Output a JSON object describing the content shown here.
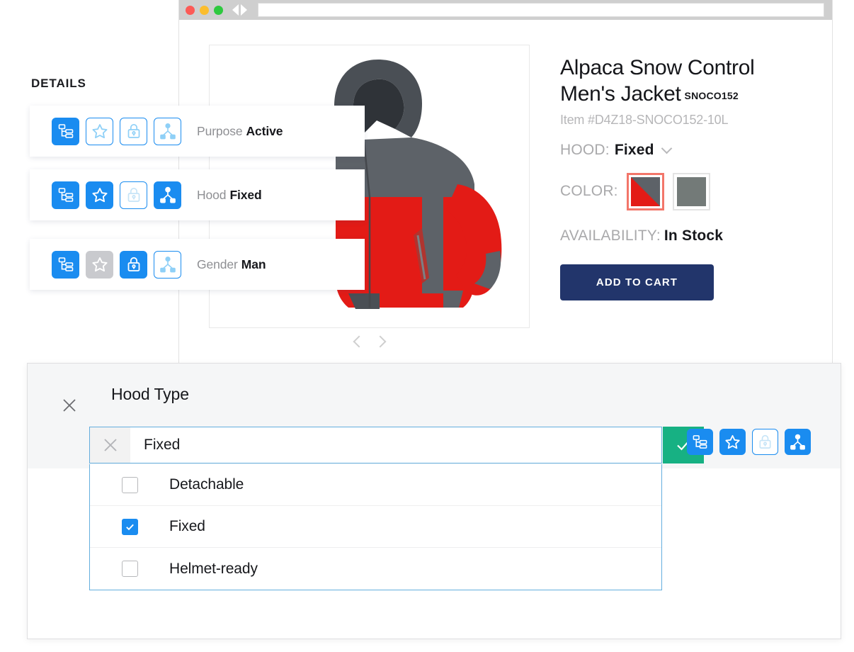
{
  "browser": {
    "traffic_lights": [
      "close",
      "minimize",
      "zoom"
    ],
    "back_label": "Back",
    "forward_label": "Forward",
    "url_value": "",
    "url_placeholder": ""
  },
  "details_panel": {
    "heading": "DETAILS",
    "rows": [
      {
        "label": "Purpose",
        "value": "Active",
        "icons": [
          {
            "name": "hierarchy-icon",
            "state": "fill"
          },
          {
            "name": "star-icon",
            "state": "outline"
          },
          {
            "name": "lock-icon",
            "state": "outline"
          },
          {
            "name": "network-icon",
            "state": "outline"
          }
        ]
      },
      {
        "label": "Hood",
        "value": "Fixed",
        "icons": [
          {
            "name": "hierarchy-icon",
            "state": "fill"
          },
          {
            "name": "star-icon",
            "state": "fill"
          },
          {
            "name": "lock-icon",
            "state": "outline"
          },
          {
            "name": "network-icon",
            "state": "fill"
          }
        ]
      },
      {
        "label": "Gender",
        "value": "Man",
        "icons": [
          {
            "name": "hierarchy-icon",
            "state": "fill"
          },
          {
            "name": "star-icon",
            "state": "muted"
          },
          {
            "name": "lock-icon",
            "state": "fill"
          },
          {
            "name": "network-icon",
            "state": "outline"
          }
        ]
      }
    ]
  },
  "product": {
    "title": "Alpaca Snow Control Men's Jacket",
    "sku_badge": "SNOCO152",
    "item_number": "Item #D4Z18-SNOCO152-10L",
    "hood_label": "HOOD:",
    "hood_value": "Fixed",
    "color_label": "COLOR:",
    "color_swatches": [
      {
        "name": "red-gray",
        "selected": true,
        "colors": [
          "#e31b16",
          "#5d6268"
        ]
      },
      {
        "name": "gray",
        "selected": false,
        "colors": [
          "#737a78"
        ]
      }
    ],
    "availability_label": "AVAILABILITY:",
    "availability_value": "In Stock",
    "add_to_cart_label": "ADD TO CART",
    "carousel_prev": "Previous image",
    "carousel_next": "Next image",
    "image_alt": "Red and gray hooded ski jacket"
  },
  "dialog": {
    "title": "Hood Type",
    "close_label": "Close",
    "input_value": "Fixed",
    "input_placeholder": "Fixed",
    "clear_label": "Clear",
    "confirm_label": "Confirm",
    "icons": [
      {
        "name": "hierarchy-icon",
        "state": "fill"
      },
      {
        "name": "star-icon",
        "state": "fill"
      },
      {
        "name": "lock-icon",
        "state": "outline"
      },
      {
        "name": "network-icon",
        "state": "fill"
      }
    ],
    "options": [
      {
        "label": "Detachable",
        "checked": false
      },
      {
        "label": "Fixed",
        "checked": true
      },
      {
        "label": "Helmet-ready",
        "checked": false
      }
    ]
  },
  "colors": {
    "accent_blue": "#1a8cf0",
    "confirm_green": "#17b183",
    "cart_navy": "#22356b",
    "swatch_selected_border": "#f3766a",
    "jacket_red": "#e31b16",
    "jacket_gray": "#5d6268",
    "jacket_dark": "#2f3338"
  }
}
